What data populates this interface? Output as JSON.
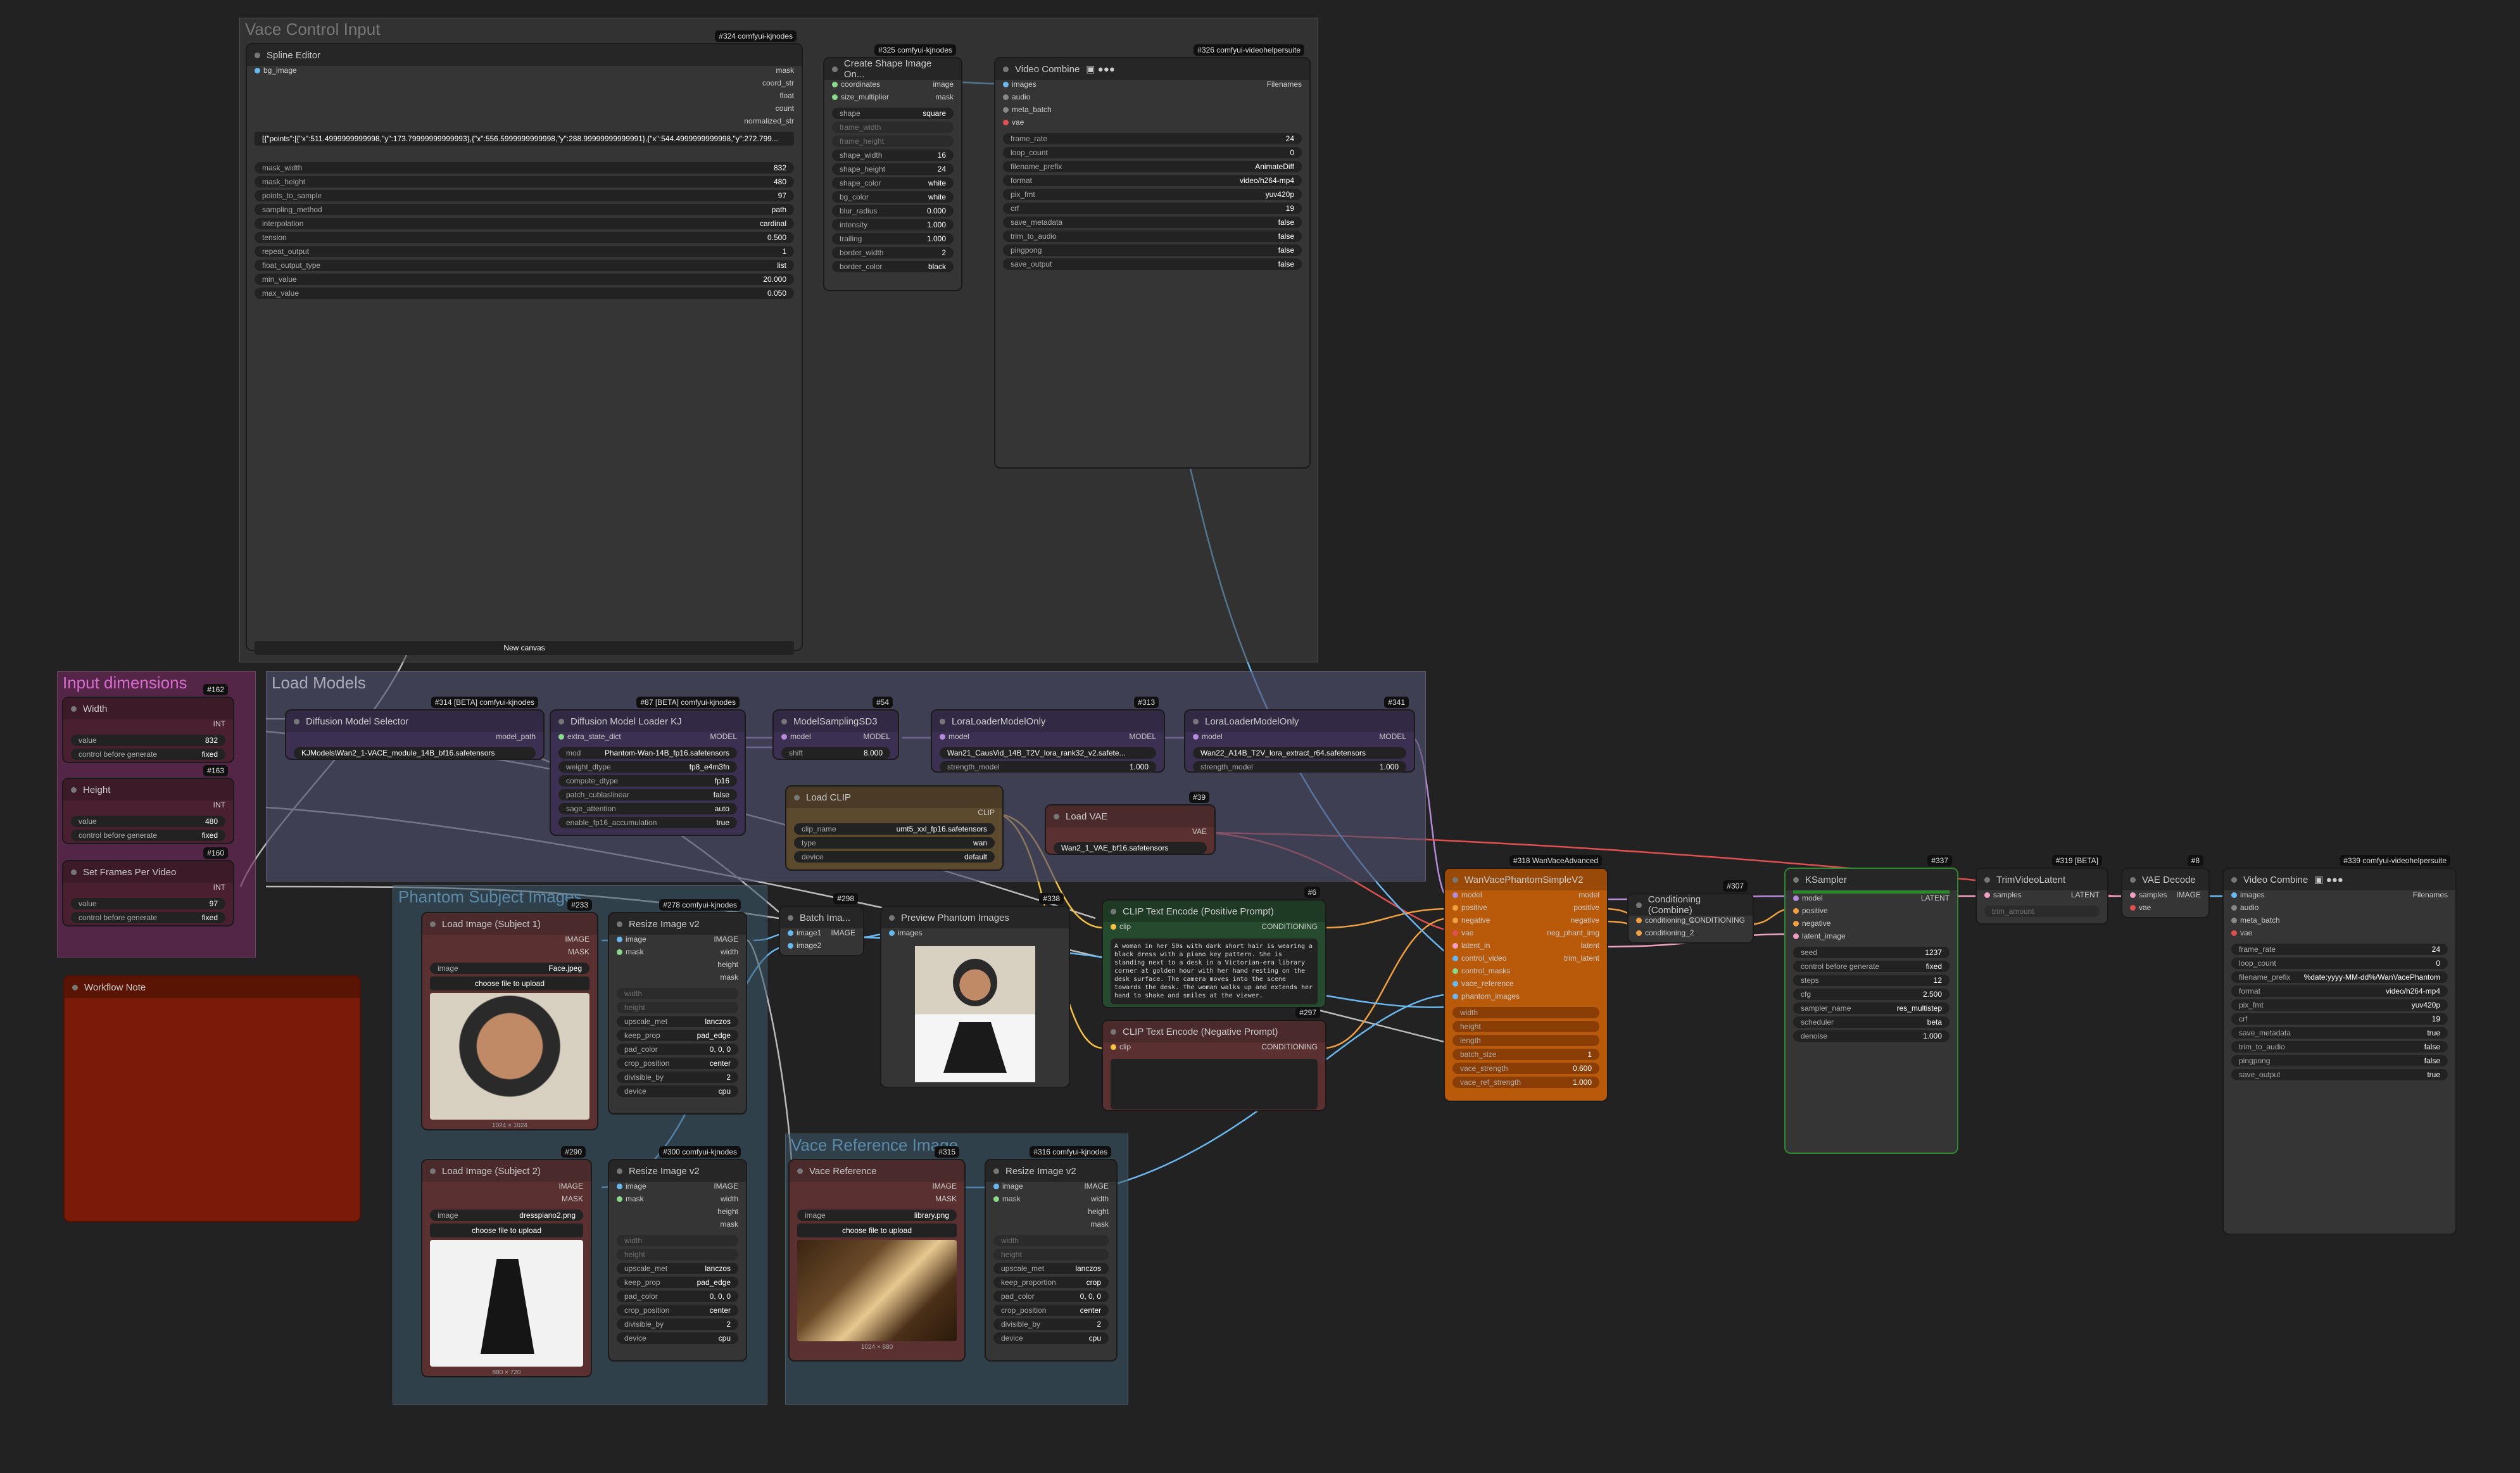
{
  "groups": {
    "vace_control": "Vace Control Input",
    "input_dims": "Input dimensions",
    "load_models": "Load Models",
    "subject_images": "Phantom Subject Images",
    "vace_reference": "Vace Reference Image"
  },
  "badges": {
    "n324": "#324 comfyui-kjnodes",
    "n325": "#325 comfyui-kjnodes",
    "n326": "#326 comfyui-videohelpersuite",
    "n162": "#162",
    "n163": "#163",
    "n160": "#160",
    "n314": "#314 [BETA] comfyui-kjnodes",
    "n87": "#87 [BETA] comfyui-kjnodes",
    "n54": "#54",
    "n313": "#313",
    "n341": "#341",
    "n39": "#39",
    "n318": "#318 WanVaceAdvanced",
    "n307": "#307",
    "n337": "#337",
    "n319": "#319 [BETA]",
    "n8": "#8",
    "n339": "#339 comfyui-videohelpersuite",
    "n233": "#233",
    "n278": "#278 comfyui-kjnodes",
    "n298": "#298",
    "n338": "#338",
    "n6": "#6",
    "n297": "#297",
    "n290": "#290",
    "n300": "#300 comfyui-kjnodes",
    "n315": "#315",
    "n316": "#316 comfyui-kjnodes"
  },
  "spline": {
    "title": "Spline Editor",
    "inputs": [
      "bg_image"
    ],
    "outputs": [
      "mask",
      "coord_str",
      "float",
      "count",
      "normalized_str"
    ],
    "points": "[{\"points\":[{\"x\":511.4999999999998,\"y\":173.79999999999993},{\"x\":556.5999999999998,\"y\":288.99999999999991},{\"x\":544.4999999999998,\"y\":272.799...",
    "widgets": [
      {
        "k": "mask_width",
        "v": "832"
      },
      {
        "k": "mask_height",
        "v": "480"
      },
      {
        "k": "points_to_sample",
        "v": "97"
      },
      {
        "k": "sampling_method",
        "v": "path"
      },
      {
        "k": "interpolation",
        "v": "cardinal"
      },
      {
        "k": "tension",
        "v": "0.500"
      },
      {
        "k": "repeat_output",
        "v": "1"
      },
      {
        "k": "float_output_type",
        "v": "list"
      },
      {
        "k": "min_value",
        "v": "20.000"
      },
      {
        "k": "max_value",
        "v": "0.050"
      }
    ],
    "new_canvas": "New canvas"
  },
  "shape": {
    "title": "Create Shape Image On...",
    "inputs": [
      "coordinates",
      "size_multiplier"
    ],
    "outputs": [
      "image",
      "mask"
    ],
    "widgets": [
      {
        "k": "shape",
        "v": "square"
      },
      {
        "k": "frame_width",
        "v": ""
      },
      {
        "k": "frame_height",
        "v": ""
      },
      {
        "k": "shape_width",
        "v": "16"
      },
      {
        "k": "shape_height",
        "v": "24"
      },
      {
        "k": "shape_color",
        "v": "white"
      },
      {
        "k": "bg_color",
        "v": "white"
      },
      {
        "k": "blur_radius",
        "v": "0.000"
      },
      {
        "k": "intensity",
        "v": "1.000"
      },
      {
        "k": "trailing",
        "v": "1.000"
      },
      {
        "k": "border_width",
        "v": "2"
      },
      {
        "k": "border_color",
        "v": "black"
      }
    ]
  },
  "video1": {
    "title": "Video Combine",
    "inputs": [
      "images",
      "audio",
      "meta_batch",
      "vae"
    ],
    "outputs": [
      "Filenames"
    ],
    "widgets": [
      {
        "k": "frame_rate",
        "v": "24"
      },
      {
        "k": "loop_count",
        "v": "0"
      },
      {
        "k": "filename_prefix",
        "v": "AnimateDiff"
      },
      {
        "k": "format",
        "v": "video/h264-mp4"
      },
      {
        "k": "pix_fmt",
        "v": "yuv420p"
      },
      {
        "k": "crf",
        "v": "19"
      },
      {
        "k": "save_metadata",
        "v": "false"
      },
      {
        "k": "trim_to_audio",
        "v": "false"
      },
      {
        "k": "pingpong",
        "v": "false"
      },
      {
        "k": "save_output",
        "v": "false"
      }
    ]
  },
  "width": {
    "title": "Width",
    "out": "INT",
    "widgets": [
      {
        "k": "value",
        "v": "832"
      },
      {
        "k": "control before generate",
        "v": "fixed"
      }
    ]
  },
  "height": {
    "title": "Height",
    "out": "INT",
    "widgets": [
      {
        "k": "value",
        "v": "480"
      },
      {
        "k": "control before generate",
        "v": "fixed"
      }
    ]
  },
  "frames": {
    "title": "Set Frames Per Video",
    "out": "INT",
    "widgets": [
      {
        "k": "value",
        "v": "97"
      },
      {
        "k": "control before generate",
        "v": "fixed"
      }
    ]
  },
  "note": {
    "title": "Workflow Note"
  },
  "dms": {
    "title": "Diffusion Model Selector",
    "out": "model_path",
    "widgets": [
      {
        "k": "",
        "v": "KJModels\\Wan2_1-VACE_module_14B_bf16.safetensors"
      }
    ]
  },
  "dml": {
    "title": "Diffusion Model Loader KJ",
    "inputs": [
      "extra_state_dict"
    ],
    "out": "MODEL",
    "widgets": [
      {
        "k": "mod",
        "v": "Phantom-Wan-14B_fp16.safetensors"
      },
      {
        "k": "weight_dtype",
        "v": "fp8_e4m3fn"
      },
      {
        "k": "compute_dtype",
        "v": "fp16"
      },
      {
        "k": "patch_cublaslinear",
        "v": "false"
      },
      {
        "k": "sage_attention",
        "v": "auto"
      },
      {
        "k": "enable_fp16_accumulation",
        "v": "true"
      }
    ]
  },
  "msd": {
    "title": "ModelSamplingSD3",
    "inputs": [
      "model"
    ],
    "out": "MODEL",
    "widgets": [
      {
        "k": "shift",
        "v": "8.000"
      }
    ]
  },
  "lora1": {
    "title": "LoraLoaderModelOnly",
    "inputs": [
      "model"
    ],
    "out": "MODEL",
    "widgets": [
      {
        "k": "lora_name",
        "v": "Wan21_CausVid_14B_T2V_lora_rank32_v2.safete..."
      },
      {
        "k": "strength_model",
        "v": "1.000"
      }
    ]
  },
  "lora2": {
    "title": "LoraLoaderModelOnly",
    "inputs": [
      "model"
    ],
    "out": "MODEL",
    "widgets": [
      {
        "k": "lora_name",
        "v": "Wan22_A14B_T2V_lora_extract_r64.safetensors"
      },
      {
        "k": "strength_model",
        "v": "1.000"
      }
    ]
  },
  "clip": {
    "title": "Load CLIP",
    "out": "CLIP",
    "widgets": [
      {
        "k": "clip_name",
        "v": "umt5_xxl_fp16.safetensors"
      },
      {
        "k": "type",
        "v": "wan"
      },
      {
        "k": "device",
        "v": "default"
      }
    ]
  },
  "vae": {
    "title": "Load VAE",
    "out": "VAE",
    "widgets": [
      {
        "k": "",
        "v": "Wan2_1_VAE_bf16.safetensors"
      }
    ]
  },
  "wan": {
    "title": "WanVacePhantomSimpleV2",
    "inputs": [
      "model",
      "positive",
      "negative",
      "vae",
      "latent_in",
      "control_video",
      "control_masks",
      "vace_reference",
      "phantom_images"
    ],
    "outputs": [
      "model",
      "positive",
      "negative",
      "neg_phant_img",
      "latent",
      "trim_latent"
    ],
    "widgets": [
      {
        "k": "width",
        "v": ""
      },
      {
        "k": "height",
        "v": ""
      },
      {
        "k": "length",
        "v": ""
      },
      {
        "k": "batch_size",
        "v": "1"
      },
      {
        "k": "vace_strength",
        "v": "0.600"
      },
      {
        "k": "vace_ref_strength",
        "v": "1.000"
      }
    ]
  },
  "cond": {
    "title": "Conditioning (Combine)",
    "inputs": [
      "conditioning_1",
      "conditioning_2"
    ],
    "out": "CONDITIONING"
  },
  "ks": {
    "title": "KSampler",
    "inputs": [
      "model",
      "positive",
      "negative",
      "latent_image"
    ],
    "out": "LATENT",
    "widgets": [
      {
        "k": "seed",
        "v": "1237"
      },
      {
        "k": "control before generate",
        "v": "fixed"
      },
      {
        "k": "steps",
        "v": "12"
      },
      {
        "k": "cfg",
        "v": "2.500"
      },
      {
        "k": "sampler_name",
        "v": "res_multistep"
      },
      {
        "k": "scheduler",
        "v": "beta"
      },
      {
        "k": "denoise",
        "v": "1.000"
      }
    ]
  },
  "trim": {
    "title": "TrimVideoLatent",
    "inputs": [
      "samples"
    ],
    "out": "LATENT",
    "widgets": [
      {
        "k": "trim_amount",
        "v": ""
      }
    ]
  },
  "vaed": {
    "title": "VAE Decode",
    "inputs": [
      "samples",
      "vae"
    ],
    "out": "IMAGE"
  },
  "video2": {
    "title": "Video Combine",
    "inputs": [
      "images",
      "audio",
      "meta_batch",
      "vae"
    ],
    "out": "Filenames",
    "widgets": [
      {
        "k": "frame_rate",
        "v": "24"
      },
      {
        "k": "loop_count",
        "v": "0"
      },
      {
        "k": "filename_prefix",
        "v": "%date:yyyy-MM-dd%/WanVacePhantom"
      },
      {
        "k": "format",
        "v": "video/h264-mp4"
      },
      {
        "k": "pix_fmt",
        "v": "yuv420p"
      },
      {
        "k": "crf",
        "v": "19"
      },
      {
        "k": "save_metadata",
        "v": "true"
      },
      {
        "k": "trim_to_audio",
        "v": "false"
      },
      {
        "k": "pingpong",
        "v": "false"
      },
      {
        "k": "save_output",
        "v": "true"
      }
    ]
  },
  "load1": {
    "title": "Load Image (Subject 1)",
    "outputs": [
      "IMAGE",
      "MASK"
    ],
    "image": "Face.jpeg",
    "upload": "choose file to upload",
    "size": "1024 × 1024"
  },
  "resize1": {
    "title": "Resize Image v2",
    "inputs": [
      "image",
      "mask"
    ],
    "outputs": [
      "IMAGE",
      "width",
      "height",
      "mask"
    ],
    "widgets": [
      {
        "k": "width",
        "v": ""
      },
      {
        "k": "height",
        "v": ""
      },
      {
        "k": "upscale_met",
        "v": "lanczos"
      },
      {
        "k": "keep_prop",
        "v": "pad_edge"
      },
      {
        "k": "pad_color",
        "v": "0, 0, 0"
      },
      {
        "k": "crop_position",
        "v": "center"
      },
      {
        "k": "divisible_by",
        "v": "2"
      },
      {
        "k": "device",
        "v": "cpu"
      }
    ]
  },
  "batch": {
    "title": "Batch Ima...",
    "inputs": [
      "image1",
      "image2"
    ],
    "out": "IMAGE"
  },
  "preview": {
    "title": "Preview Phantom Images",
    "inputs": [
      "images"
    ]
  },
  "pos": {
    "title": "CLIP Text Encode (Positive Prompt)",
    "inputs": [
      "clip"
    ],
    "out": "CONDITIONING",
    "text": "A woman in her 50s with dark short hair is wearing a black dress with a piano key pattern. She is standing next to a desk in a Victorian-era library corner at golden hour with her hand resting on the desk surface. The camera moves into the scene towards the desk. The woman walks up and extends her hand to shake and smiles at the viewer."
  },
  "neg": {
    "title": "CLIP Text Encode (Negative Prompt)",
    "inputs": [
      "clip"
    ],
    "out": "CONDITIONING",
    "text": ""
  },
  "load2": {
    "title": "Load Image (Subject 2)",
    "outputs": [
      "IMAGE",
      "MASK"
    ],
    "image": "dresspiano2.png",
    "upload": "choose file to upload",
    "size": "880 × 720"
  },
  "resize2": {
    "title": "Resize Image v2",
    "inputs": [
      "image",
      "mask"
    ],
    "outputs": [
      "IMAGE",
      "width",
      "height",
      "mask"
    ],
    "widgets": [
      {
        "k": "width",
        "v": ""
      },
      {
        "k": "height",
        "v": ""
      },
      {
        "k": "upscale_met",
        "v": "lanczos"
      },
      {
        "k": "keep_prop",
        "v": "pad_edge"
      },
      {
        "k": "pad_color",
        "v": "0, 0, 0"
      },
      {
        "k": "crop_position",
        "v": "center"
      },
      {
        "k": "divisible_by",
        "v": "2"
      },
      {
        "k": "device",
        "v": "cpu"
      }
    ]
  },
  "vref": {
    "title": "Vace Reference",
    "outputs": [
      "IMAGE",
      "MASK"
    ],
    "image": "library.png",
    "upload": "choose file to upload",
    "size": "1024 × 680"
  },
  "resize3": {
    "title": "Resize Image v2",
    "inputs": [
      "image",
      "mask"
    ],
    "outputs": [
      "IMAGE",
      "width",
      "height",
      "mask"
    ],
    "widgets": [
      {
        "k": "width",
        "v": ""
      },
      {
        "k": "height",
        "v": ""
      },
      {
        "k": "upscale_met",
        "v": "lanczos"
      },
      {
        "k": "keep_proportion",
        "v": "crop"
      },
      {
        "k": "pad_color",
        "v": "0, 0, 0"
      },
      {
        "k": "crop_position",
        "v": "center"
      },
      {
        "k": "divisible_by",
        "v": "2"
      },
      {
        "k": "device",
        "v": "cpu"
      }
    ]
  },
  "colors": {
    "wire_blue": "#6ab8f0",
    "wire_purple": "#b58ad8",
    "wire_yellow": "#f5c242",
    "wire_orange": "#f0a040",
    "wire_red": "#e05050",
    "wire_pink": "#f0a0c0",
    "wire_grey": "#9a9a9a"
  }
}
